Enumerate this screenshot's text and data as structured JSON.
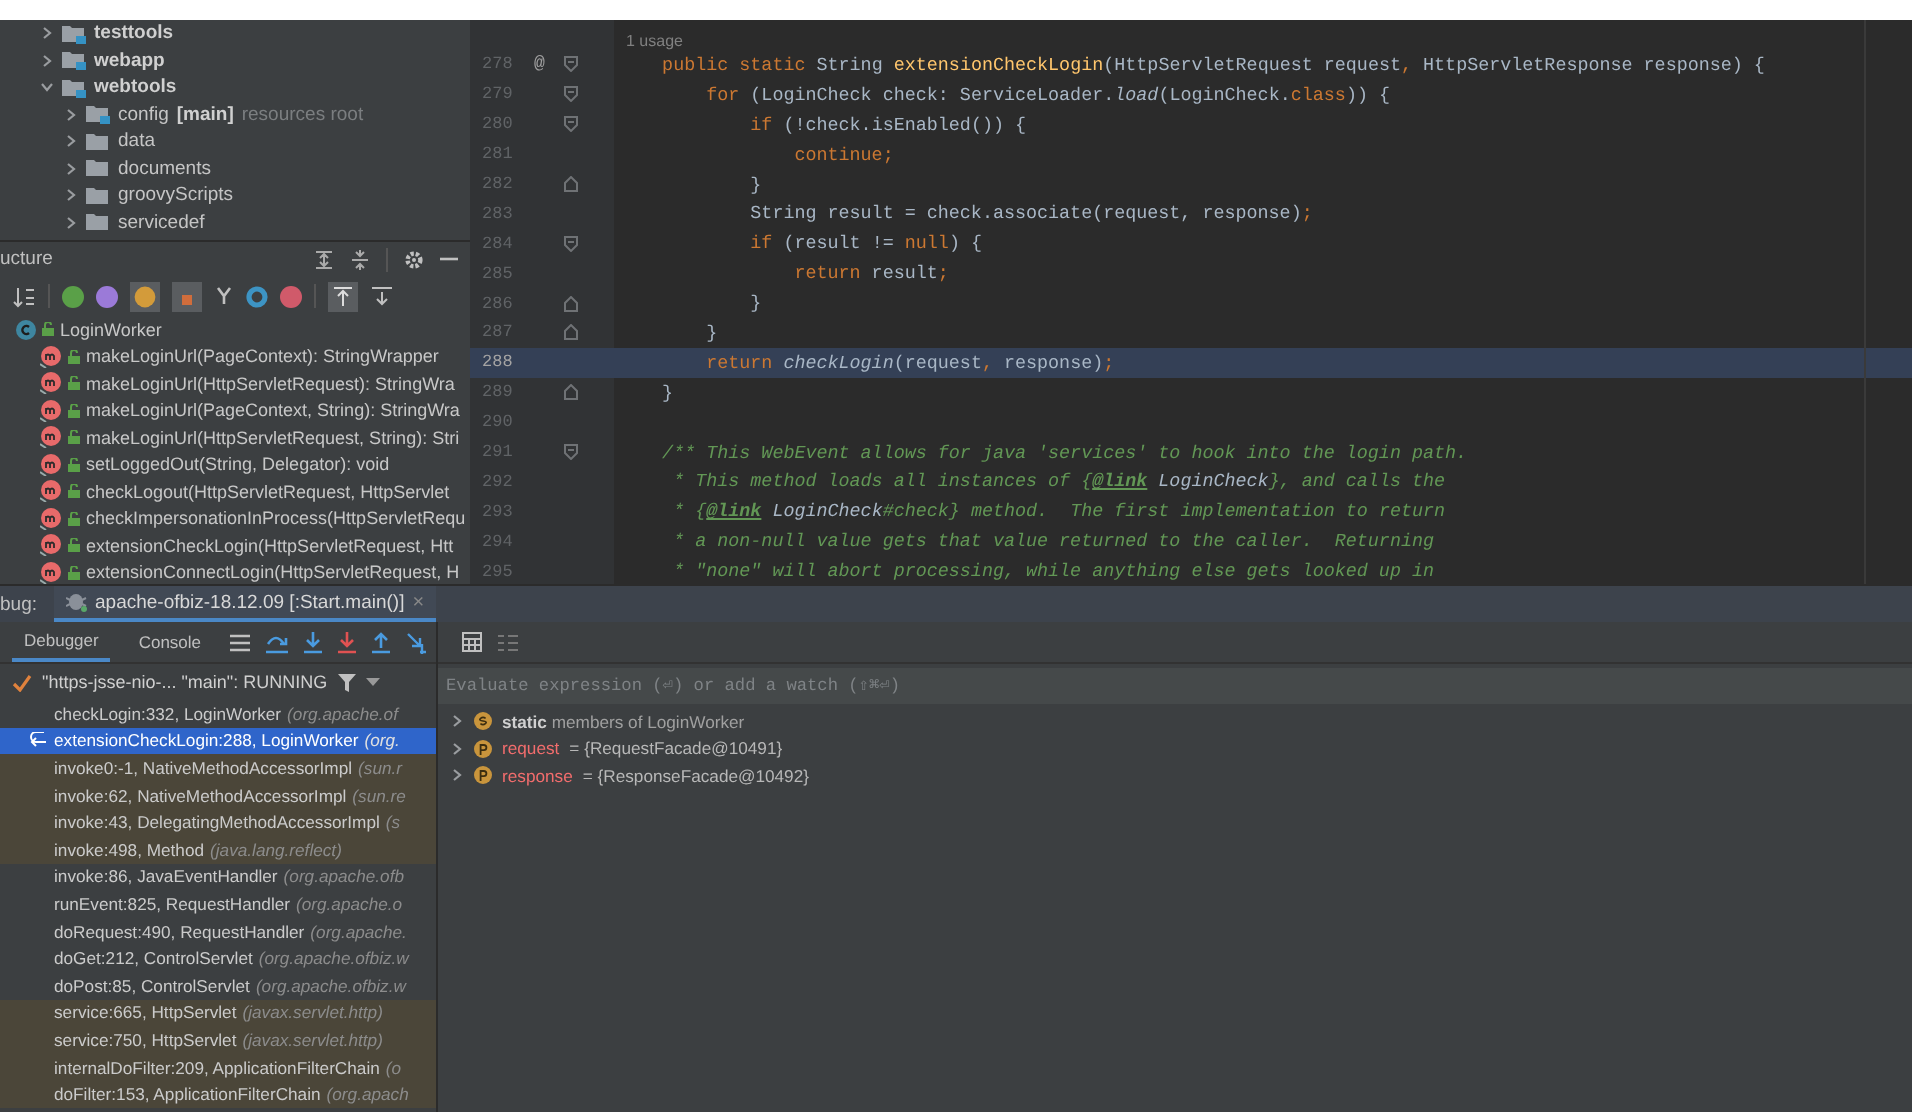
{
  "project_tree": [
    {
      "label": "testtools",
      "kind": "module",
      "expanded": false
    },
    {
      "label": "webapp",
      "kind": "module",
      "expanded": false
    },
    {
      "label": "webtools",
      "kind": "module",
      "expanded": true,
      "children": [
        {
          "label": "config",
          "kind": "module",
          "suffix": "[main]",
          "hint": "resources root",
          "expanded": false
        },
        {
          "label": "data",
          "kind": "folder",
          "expanded": false
        },
        {
          "label": "documents",
          "kind": "folder",
          "expanded": false
        },
        {
          "label": "groovyScripts",
          "kind": "folder",
          "expanded": false
        },
        {
          "label": "servicedef",
          "kind": "folder",
          "expanded": false
        }
      ]
    }
  ],
  "structure": {
    "title": "ucture",
    "items": [
      {
        "label": "LoginWorker",
        "kind": "class",
        "children": [
          {
            "label": "makeLoginUrl(PageContext): StringWrapper",
            "kind": "method"
          },
          {
            "label": "makeLoginUrl(HttpServletRequest): StringWra",
            "kind": "method"
          },
          {
            "label": "makeLoginUrl(PageContext, String): StringWra",
            "kind": "method"
          },
          {
            "label": "makeLoginUrl(HttpServletRequest, String): Stri",
            "kind": "method"
          },
          {
            "label": "setLoggedOut(String, Delegator): void",
            "kind": "method"
          },
          {
            "label": "checkLogout(HttpServletRequest, HttpServlet",
            "kind": "method"
          },
          {
            "label": "checkImpersonationInProcess(HttpServletRequ",
            "kind": "method"
          },
          {
            "label": "extensionCheckLogin(HttpServletRequest, Htt",
            "kind": "method"
          },
          {
            "label": "extensionConnectLogin(HttpServletRequest, H",
            "kind": "method"
          }
        ]
      }
    ]
  },
  "editor": {
    "usage_hint": "1 usage",
    "lines": [
      {
        "number": "278",
        "marker": "@",
        "fold_start": true,
        "fold_end": false,
        "current": false,
        "tokens": [
          {
            "kind": "kw",
            "text": "    public static "
          },
          {
            "kind": "plain",
            "text": "String "
          },
          {
            "kind": "fn",
            "text": "extensionCheckLogin"
          },
          {
            "kind": "plain",
            "text": "(HttpServletRequest request"
          },
          {
            "kind": "kw",
            "text": ","
          },
          {
            "kind": "plain",
            "text": " HttpServletResponse response) {"
          }
        ]
      },
      {
        "number": "279",
        "fold_start": true,
        "fold_end": false,
        "current": false,
        "tokens": [
          {
            "kind": "kw",
            "text": "        for"
          },
          {
            "kind": "plain",
            "text": " (LoginCheck check: ServiceLoader."
          },
          {
            "kind": "italic",
            "text": "load"
          },
          {
            "kind": "plain",
            "text": "(LoginCheck."
          },
          {
            "kind": "kw",
            "text": "class"
          },
          {
            "kind": "plain",
            "text": ")) {"
          }
        ]
      },
      {
        "number": "280",
        "fold_start": true,
        "fold_end": false,
        "current": false,
        "tokens": [
          {
            "kind": "kw",
            "text": "            if"
          },
          {
            "kind": "plain",
            "text": " (!check.isEnabled()) {"
          }
        ]
      },
      {
        "number": "281",
        "fold_start": false,
        "fold_end": false,
        "current": false,
        "tokens": [
          {
            "kind": "kw",
            "text": "                continue;"
          }
        ]
      },
      {
        "number": "282",
        "fold_start": false,
        "fold_end": true,
        "current": false,
        "tokens": [
          {
            "kind": "plain",
            "text": "            }"
          }
        ]
      },
      {
        "number": "283",
        "fold_start": false,
        "fold_end": false,
        "current": false,
        "tokens": [
          {
            "kind": "plain",
            "text": "            String result = check.associate(request, response)"
          },
          {
            "kind": "kw",
            "text": ";"
          }
        ]
      },
      {
        "number": "284",
        "fold_start": true,
        "fold_end": false,
        "current": false,
        "tokens": [
          {
            "kind": "kw",
            "text": "            if"
          },
          {
            "kind": "plain",
            "text": " (result != "
          },
          {
            "kind": "kw",
            "text": "null"
          },
          {
            "kind": "plain",
            "text": ") {"
          }
        ]
      },
      {
        "number": "285",
        "fold_start": false,
        "fold_end": false,
        "current": false,
        "tokens": [
          {
            "kind": "kw",
            "text": "                return"
          },
          {
            "kind": "plain",
            "text": " result"
          },
          {
            "kind": "kw",
            "text": ";"
          }
        ]
      },
      {
        "number": "286",
        "fold_start": false,
        "fold_end": true,
        "current": false,
        "tokens": [
          {
            "kind": "plain",
            "text": "            }"
          }
        ]
      },
      {
        "number": "287",
        "fold_start": false,
        "fold_end": true,
        "current": false,
        "tokens": [
          {
            "kind": "plain",
            "text": "        }"
          }
        ]
      },
      {
        "number": "288",
        "fold_start": false,
        "fold_end": false,
        "current": true,
        "tokens": [
          {
            "kind": "kw",
            "text": "        return "
          },
          {
            "kind": "italic",
            "text": "checkLogin"
          },
          {
            "kind": "plain",
            "text": "(request"
          },
          {
            "kind": "kw",
            "text": ","
          },
          {
            "kind": "plain",
            "text": " response)"
          },
          {
            "kind": "kw",
            "text": ";"
          }
        ]
      },
      {
        "number": "289",
        "fold_start": false,
        "fold_end": true,
        "current": false,
        "tokens": [
          {
            "kind": "plain",
            "text": "    }"
          }
        ]
      },
      {
        "number": "290",
        "fold_start": false,
        "fold_end": false,
        "current": false
      },
      {
        "number": "291",
        "fold_start": true,
        "fold_end": false,
        "current": false,
        "tokens": [
          {
            "kind": "comment",
            "text": "    /** This WebEvent allows for java 'services' to hook into the login path."
          }
        ]
      },
      {
        "number": "292",
        "fold_start": false,
        "fold_end": false,
        "current": false,
        "tokens": [
          {
            "kind": "comment",
            "text": "     * This method loads all instances of {"
          },
          {
            "kind": "tag",
            "text": "@link"
          },
          {
            "kind": "ref",
            "text": " LoginCheck"
          },
          {
            "kind": "comment",
            "text": "}, and calls the"
          }
        ]
      },
      {
        "number": "293",
        "fold_start": false,
        "fold_end": false,
        "current": false,
        "tokens": [
          {
            "kind": "comment",
            "text": "     * {"
          },
          {
            "kind": "tag",
            "text": "@link"
          },
          {
            "kind": "ref",
            "text": " LoginCheck"
          },
          {
            "kind": "comment",
            "text": "#check} method.  The first implementation to return"
          }
        ]
      },
      {
        "number": "294",
        "fold_start": false,
        "fold_end": false,
        "current": false,
        "tokens": [
          {
            "kind": "comment",
            "text": "     * a non-null value gets that value returned to the caller.  Returning"
          }
        ]
      },
      {
        "number": "295",
        "fold_start": false,
        "fold_end": false,
        "current": false,
        "tokens": [
          {
            "kind": "comment",
            "text": "     * \"none\" will abort processing, while anything else gets looked up in"
          }
        ]
      }
    ]
  },
  "debug": {
    "label": "bug:",
    "session_tab": "apache-ofbiz-18.12.09 [:Start.main()]",
    "close": "×",
    "tabs": [
      {
        "label": "Debugger",
        "selected": true
      },
      {
        "label": "Console",
        "selected": false
      }
    ],
    "thread": "\"https-jsse-nio-... \"main\": RUNNING",
    "frames": [
      {
        "method": "checkLogin:332, LoginWorker",
        "package": "(org.apache.of",
        "kind": "app",
        "selected": false
      },
      {
        "method": "extensionCheckLogin:288, LoginWorker",
        "package": "(org.",
        "kind": "app",
        "selected": true
      },
      {
        "method": "invoke0:-1, NativeMethodAccessorImpl",
        "package": "(sun.r",
        "kind": "library",
        "selected": false
      },
      {
        "method": "invoke:62, NativeMethodAccessorImpl",
        "package": "(sun.re",
        "kind": "library",
        "selected": false
      },
      {
        "method": "invoke:43, DelegatingMethodAccessorImpl",
        "package": "(s",
        "kind": "library",
        "selected": false
      },
      {
        "method": "invoke:498, Method",
        "package": "(java.lang.reflect)",
        "kind": "library",
        "selected": false
      },
      {
        "method": "invoke:86, JavaEventHandler",
        "package": "(org.apache.ofb",
        "kind": "app",
        "selected": false
      },
      {
        "method": "runEvent:825, RequestHandler",
        "package": "(org.apache.o",
        "kind": "app",
        "selected": false
      },
      {
        "method": "doRequest:490, RequestHandler",
        "package": "(org.apache.",
        "kind": "app",
        "selected": false
      },
      {
        "method": "doGet:212, ControlServlet",
        "package": "(org.apache.ofbiz.w",
        "kind": "app",
        "selected": false
      },
      {
        "method": "doPost:85, ControlServlet",
        "package": "(org.apache.ofbiz.w",
        "kind": "app",
        "selected": false
      },
      {
        "method": "service:665, HttpServlet",
        "package": "(javax.servlet.http)",
        "kind": "library",
        "selected": false
      },
      {
        "method": "service:750, HttpServlet",
        "package": "(javax.servlet.http)",
        "kind": "library",
        "selected": false
      },
      {
        "method": "internalDoFilter:209, ApplicationFilterChain",
        "package": "(o",
        "kind": "library",
        "selected": false
      },
      {
        "method": "doFilter:153, ApplicationFilterChain",
        "package": "(org.apach",
        "kind": "library",
        "selected": false
      }
    ],
    "watch_placeholder": "Evaluate expression (⏎) or add a watch (⇧⌘⏎)",
    "variables": [
      {
        "kind": "static",
        "text": "**static** members of LoginWorker"
      },
      {
        "kind": "param",
        "name": "request",
        "value": "= {RequestFacade@10491}"
      },
      {
        "kind": "param",
        "name": "response",
        "value": "= {ResponseFacade@10492}"
      }
    ]
  }
}
